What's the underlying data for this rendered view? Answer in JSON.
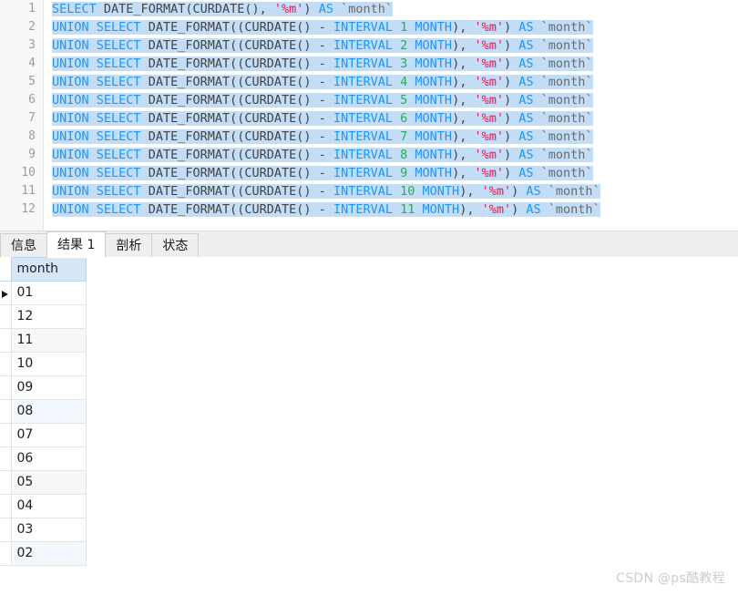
{
  "editor": {
    "line_numbers": [
      "1",
      "2",
      "3",
      "4",
      "5",
      "6",
      "7",
      "8",
      "9",
      "10",
      "11",
      "12"
    ],
    "lines": [
      {
        "n": "1",
        "text": "SELECT DATE_FORMAT(CURDATE(), '%m') AS `month`"
      },
      {
        "n": "2",
        "text": "UNION SELECT DATE_FORMAT((CURDATE() - INTERVAL 1 MONTH), '%m') AS `month`"
      },
      {
        "n": "3",
        "text": "UNION SELECT DATE_FORMAT((CURDATE() - INTERVAL 2 MONTH), '%m') AS `month`"
      },
      {
        "n": "4",
        "text": "UNION SELECT DATE_FORMAT((CURDATE() - INTERVAL 3 MONTH), '%m') AS `month`"
      },
      {
        "n": "5",
        "text": "UNION SELECT DATE_FORMAT((CURDATE() - INTERVAL 4 MONTH), '%m') AS `month`"
      },
      {
        "n": "6",
        "text": "UNION SELECT DATE_FORMAT((CURDATE() - INTERVAL 5 MONTH), '%m') AS `month`"
      },
      {
        "n": "7",
        "text": "UNION SELECT DATE_FORMAT((CURDATE() - INTERVAL 6 MONTH), '%m') AS `month`"
      },
      {
        "n": "8",
        "text": "UNION SELECT DATE_FORMAT((CURDATE() - INTERVAL 7 MONTH), '%m') AS `month`"
      },
      {
        "n": "9",
        "text": "UNION SELECT DATE_FORMAT((CURDATE() - INTERVAL 8 MONTH), '%m') AS `month`"
      },
      {
        "n": "10",
        "text": "UNION SELECT DATE_FORMAT((CURDATE() - INTERVAL 9 MONTH), '%m') AS `month`"
      },
      {
        "n": "11",
        "text": "UNION SELECT DATE_FORMAT((CURDATE() - INTERVAL 10 MONTH), '%m') AS `month`"
      },
      {
        "n": "12",
        "text": "UNION SELECT DATE_FORMAT((CURDATE() - INTERVAL 11 MONTH), '%m') AS `month`"
      }
    ],
    "colors": {
      "keyword": "#2196f3",
      "number": "#22b14c",
      "string": "#e8174f",
      "identifier": "#6a6a6a",
      "plain": "#444444",
      "selection": "#c3ddf6",
      "gutter_text": "#9b9b9b"
    }
  },
  "tabs": [
    {
      "label": "信息",
      "active": false
    },
    {
      "label": "结果 1",
      "active": true
    },
    {
      "label": "剖析",
      "active": false
    },
    {
      "label": "状态",
      "active": false
    }
  ],
  "result_grid": {
    "columns": [
      "month"
    ],
    "rows": [
      {
        "month": "01",
        "tint": "none",
        "current": true
      },
      {
        "month": "12",
        "tint": "none",
        "current": false
      },
      {
        "month": "11",
        "tint": "gray",
        "current": false
      },
      {
        "month": "10",
        "tint": "none",
        "current": false
      },
      {
        "month": "09",
        "tint": "none",
        "current": false
      },
      {
        "month": "08",
        "tint": "blue",
        "current": false
      },
      {
        "month": "07",
        "tint": "none",
        "current": false
      },
      {
        "month": "06",
        "tint": "none",
        "current": false
      },
      {
        "month": "05",
        "tint": "gray",
        "current": false
      },
      {
        "month": "04",
        "tint": "none",
        "current": false
      },
      {
        "month": "03",
        "tint": "none",
        "current": false
      },
      {
        "month": "02",
        "tint": "blue",
        "current": false
      }
    ],
    "header_bg": "#d6e6f5"
  },
  "watermark": {
    "text": "CSDN @ps酷教程"
  }
}
